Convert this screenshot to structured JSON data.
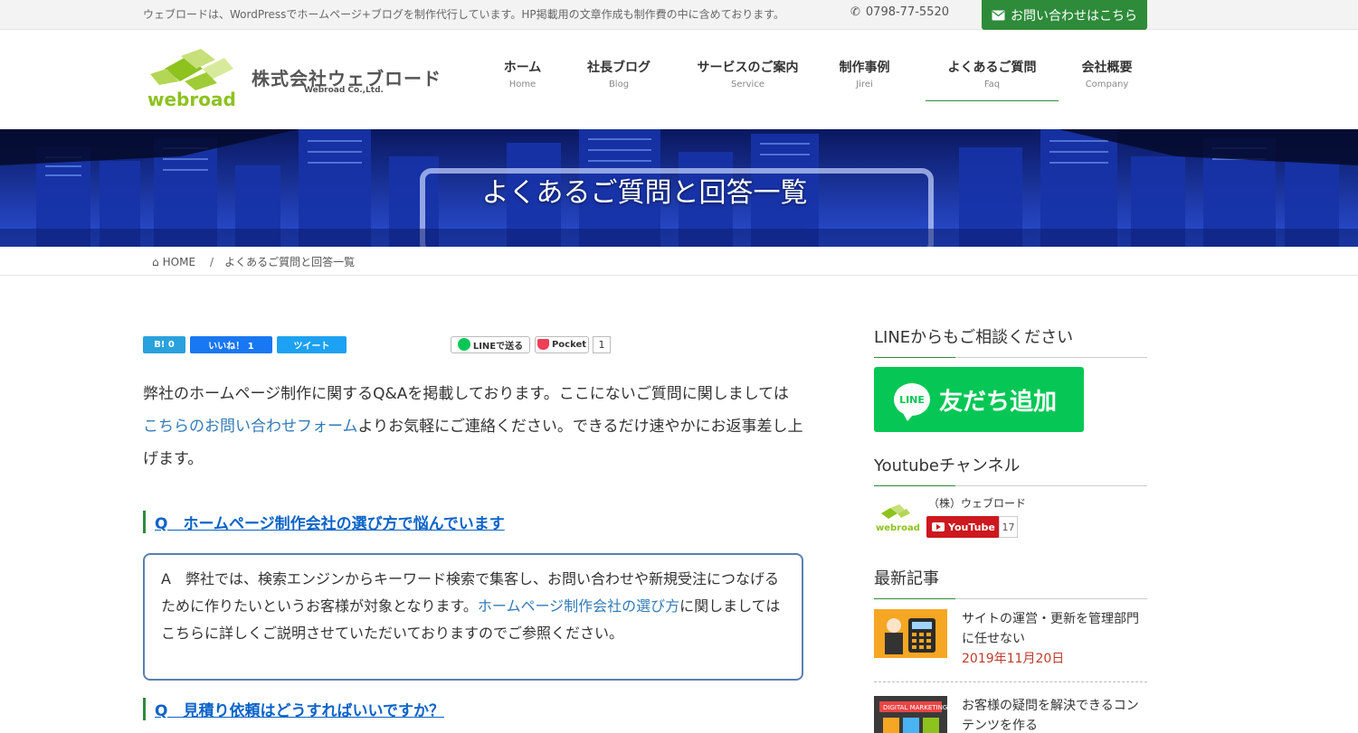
{
  "topbar": {
    "tagline": "ウェブロードは、WordPressでホームページ+ブログを制作代行しています。HP掲載用の文章作成も制作費の中に含めております。",
    "phone": "0798-77-5520",
    "contact_label": "お問い合わせはこちら"
  },
  "logo": {
    "company": "株式会社ウェブロード",
    "company_en": "Webroad Co.,Ltd.",
    "word": "webroad"
  },
  "nav": [
    {
      "jp": "ホーム",
      "en": "Home"
    },
    {
      "jp": "社長ブログ",
      "en": "Blog"
    },
    {
      "jp": "サービスのご案内",
      "en": "Service"
    },
    {
      "jp": "制作事例",
      "en": "Jirei"
    },
    {
      "jp": "よくあるご質問",
      "en": "Faq"
    },
    {
      "jp": "会社概要",
      "en": "Company"
    }
  ],
  "hero": {
    "title": "よくあるご質問と回答一覧"
  },
  "breadcrumb": {
    "home": "HOME",
    "separator": "/",
    "current": "よくあるご質問と回答一覧"
  },
  "share": {
    "hatena": "B! 0",
    "facebook": "いいね！ 1",
    "twitter": "ツイート",
    "line": "LINEで送る",
    "pocket": "Pocket",
    "pocket_count": "1"
  },
  "intro": {
    "text_before": "弊社のホームページ制作に関するQ&Aを掲載しております。ここにないご質問に関しましては",
    "link": "こちらのお問い合わせフォーム",
    "text_after": "よりお気軽にご連絡ください。できるだけ速やかにお返事差し上げます。"
  },
  "faq": [
    {
      "q": "Q　ホームページ制作会社の選び方で悩んでいます",
      "a_before": "A　弊社では、検索エンジンからキーワード検索で集客し、お問い合わせや新規受注につなげるために作りたいというお客様が対象となります。",
      "a_link": "ホームページ制作会社の選び方",
      "a_after": "に関しましてはこちらに詳しくご説明させていただいておりますのでご参照ください。"
    },
    {
      "q": "Q　見積り依頼はどうすればいいですか？"
    }
  ],
  "sidebar": {
    "line_heading": "LINEからもご相談ください",
    "line_icon": "LINE",
    "line_button": "友だち追加",
    "youtube_heading": "Youtubeチャンネル",
    "youtube_channel": "（株）ウェブロード",
    "youtube_button": "YouTube",
    "youtube_count": "17",
    "latest_heading": "最新記事",
    "posts": [
      {
        "title": "サイトの運営・更新を管理部門に任せない",
        "date": "2019年11月20日"
      },
      {
        "title": "お客様の疑問を解決できるコンテンツを作る",
        "date": ""
      }
    ],
    "thumb2_text": "DIGITAL MARKETING"
  },
  "colors": {
    "green": "#2e8b3a",
    "line_green": "#06c755",
    "link_blue": "#337ab7",
    "faq_q_blue": "#0b63c8",
    "date_red": "#c0392b"
  }
}
